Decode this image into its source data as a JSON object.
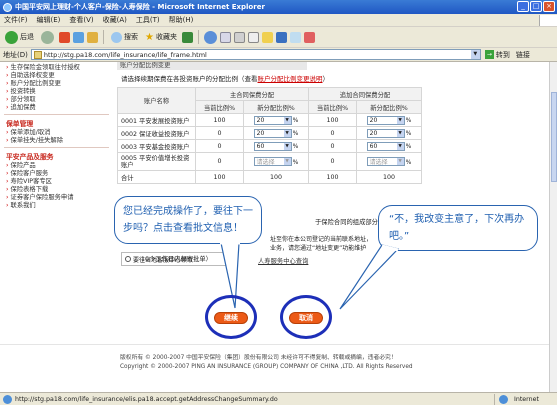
{
  "window": {
    "title": "中国平安网上理财-个人客户-保险-人寿保险 - Microsoft Internet Explorer"
  },
  "menu": [
    "文件(F)",
    "编辑(E)",
    "查看(V)",
    "收藏(A)",
    "工具(T)",
    "帮助(H)"
  ],
  "toolbar": {
    "back": "后退",
    "search": "搜索",
    "favorites": "收藏夹"
  },
  "address": {
    "label": "地址(D)",
    "url": "http://stg.pa18.com/life_insurance/life_frame.html",
    "go": "转到",
    "links": "链接"
  },
  "sidebar": {
    "items_top": [
      "生存保险金领取往付授权",
      "自助选择权变更",
      "账户分配比例变更",
      "投资转换",
      "部分领取",
      "追加保费"
    ],
    "group2_title": "保单管理",
    "items_2": [
      "保单添加/取消",
      "保单挂失/挂失解除"
    ],
    "group3_title": "平安产品及服务",
    "items_3": [
      "保险产品",
      "保险客户服务",
      "寿险VIP客专区",
      "保险表格下载",
      "证券客户保险服务申请",
      "联系我们"
    ]
  },
  "main": {
    "section_tab": "账户分配比例变更",
    "intro_text": "请选择续期保费在各投资账户的分配比例（查看",
    "intro_link": "账户分配比例变更说明",
    "intro_close": "）",
    "table": {
      "col_account": "账户名称",
      "group_main": "主合同保费分配",
      "group_add": "追加合同保费分配",
      "sub_current": "当前比例%",
      "sub_new": "新分配比例%",
      "rows": [
        {
          "name": "0001 平安发展投资账户",
          "main_cur": "100",
          "main_new": "20",
          "add_cur": "100",
          "add_new": "20"
        },
        {
          "name": "0002 保证收益投资账户",
          "main_cur": "0",
          "main_new": "20",
          "add_cur": "0",
          "add_new": "20"
        },
        {
          "name": "0003 平安基金投资账户",
          "main_cur": "0",
          "main_new": "60",
          "add_cur": "0",
          "add_new": "60"
        },
        {
          "name": "0005 平安价值增长投资账户",
          "main_cur": "0",
          "main_new": "请选择",
          "add_cur": "0",
          "add_new": "请选择"
        }
      ],
      "total_label": "合计",
      "total_main_cur": "100",
      "total_main_new": "100",
      "total_add_cur": "100",
      "total_add_new": "100"
    },
    "note_right": "于保险合同的组成部分）：",
    "note_left": "10个工作日内邮寄批单）",
    "notice_1": "址至你在本公司登记的当前联系地址，",
    "notice_2": "业务，请您通过“地址变更”功能维护",
    "agent_text": "要往当地客服中心领取",
    "service_link": "人寿服务中心查询",
    "continue_btn": "继续",
    "cancel_btn": "取消",
    "bubble_left": "您已经完成操作了，要往下一步吗？点击查看批文信息！",
    "bubble_right": "“不，我改变主意了，下次再办吧。”",
    "footer_1": "版权所有 © 2000-2007 中国平安保险（集团）股份有限公司 未经许可不得复制、转载或摘编，违者必究！",
    "footer_2": "Copyright © 2000-2007 PING AN INSURANCE (GROUP) COMPANY OF CHINA ,LTD. All Rights Reserved"
  },
  "status": {
    "url": "http://stg.pa18.com/life_insurance/elis.pa18.accept.getAddressChangeSummary.do",
    "zone": "Internet"
  }
}
